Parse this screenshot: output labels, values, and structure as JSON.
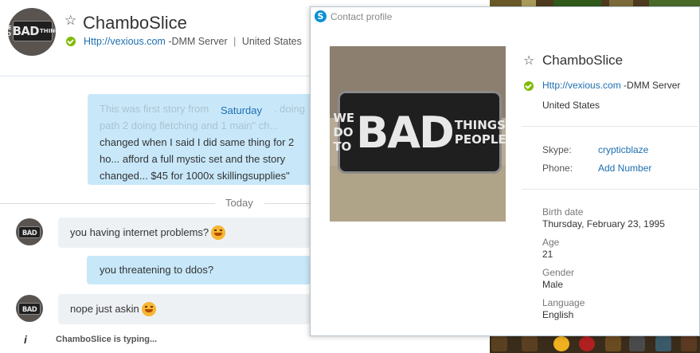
{
  "chat": {
    "contact_name": "ChamboSlice",
    "mood_link": "Http://vexious.com",
    "mood_rest": "-DMM Server",
    "mood_sep": "|",
    "country": "United States",
    "old_message_faded": "This was first story from ... had 3 acc... doing path 2 doing fletching and 1 main\" ch...",
    "old_message": "changed when I said I did same thing for 2 ho... afford a full mystic set and the story changed... $45 for 1000x skillingsupplies\"",
    "day_label": "Saturday",
    "today_label": "Today",
    "messages": [
      {
        "text": "you having internet problems?",
        "direction": "in",
        "emoji": "smile-icon"
      },
      {
        "text": "you threatening to ddos?",
        "direction": "out"
      },
      {
        "text": "nope just askin",
        "direction": "in",
        "emoji": "smile-icon"
      }
    ],
    "typing_symbol": "i",
    "typing_text": "ChamboSlice is typing..."
  },
  "avatar": {
    "patch_words": [
      "WE DO",
      "BAD",
      "THINGS",
      "TO",
      "PEOPLE"
    ]
  },
  "profile": {
    "window_title": "Contact profile",
    "name": "ChamboSlice",
    "mood_link": "Http://vexious.com",
    "mood_rest": "-DMM Server",
    "country": "United States",
    "skype_label": "Skype:",
    "skype_value": "crypticblaze",
    "phone_label": "Phone:",
    "phone_value": "Add Number",
    "birth_label": "Birth date",
    "birth_value": "Thursday, February 23, 1995",
    "age_label": "Age",
    "age_value": "21",
    "gender_label": "Gender",
    "gender_value": "Male",
    "language_label": "Language",
    "language_value": "English"
  },
  "colors": {
    "accent": "#1e6fb0",
    "online": "#7fba00",
    "bubble_out": "#c8e8fa",
    "bubble_in": "#eef1f4"
  }
}
